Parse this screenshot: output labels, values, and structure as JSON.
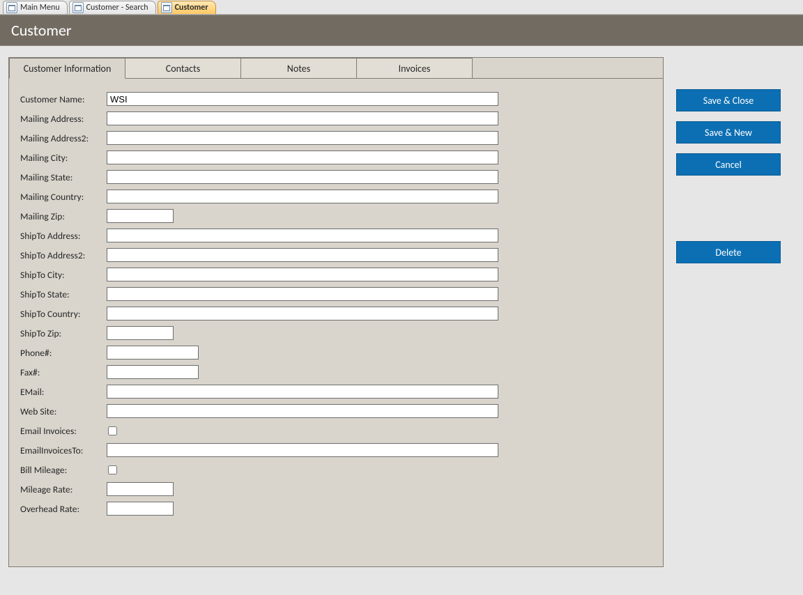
{
  "tabstrip": {
    "tabs": [
      {
        "label": "Main Menu",
        "active": false
      },
      {
        "label": "Customer - Search",
        "active": false
      },
      {
        "label": "Customer",
        "active": true
      }
    ]
  },
  "header": {
    "title": "Customer"
  },
  "form": {
    "tabs": [
      {
        "label": "Customer Information",
        "active": true
      },
      {
        "label": "Contacts",
        "active": false
      },
      {
        "label": "Notes",
        "active": false
      },
      {
        "label": "Invoices",
        "active": false
      }
    ],
    "fields": {
      "customer_name": {
        "label": "Customer Name:",
        "value": "WSI",
        "width": "long"
      },
      "mailing_address": {
        "label": "Mailing Address:",
        "value": "",
        "width": "long"
      },
      "mailing_address2": {
        "label": "Mailing Address2:",
        "value": "",
        "width": "long"
      },
      "mailing_city": {
        "label": "Mailing City:",
        "value": "",
        "width": "long"
      },
      "mailing_state": {
        "label": "Mailing State:",
        "value": "",
        "width": "long"
      },
      "mailing_country": {
        "label": "Mailing Country:",
        "value": "",
        "width": "long"
      },
      "mailing_zip": {
        "label": "Mailing Zip:",
        "value": "",
        "width": "short"
      },
      "shipto_address": {
        "label": "ShipTo Address:",
        "value": "",
        "width": "long"
      },
      "shipto_address2": {
        "label": "ShipTo Address2:",
        "value": "",
        "width": "long"
      },
      "shipto_city": {
        "label": "ShipTo City:",
        "value": "",
        "width": "long"
      },
      "shipto_state": {
        "label": "ShipTo State:",
        "value": "",
        "width": "long"
      },
      "shipto_country": {
        "label": "ShipTo Country:",
        "value": "",
        "width": "long"
      },
      "shipto_zip": {
        "label": "ShipTo Zip:",
        "value": "",
        "width": "short"
      },
      "phone": {
        "label": "Phone#:",
        "value": "",
        "width": "med"
      },
      "fax": {
        "label": "Fax#:",
        "value": "",
        "width": "med"
      },
      "email": {
        "label": "EMail:",
        "value": "",
        "width": "long"
      },
      "website": {
        "label": "Web Site:",
        "value": "",
        "width": "long"
      },
      "email_invoices": {
        "label": "Email Invoices:",
        "checked": false
      },
      "email_invoices_to": {
        "label": "EmailInvoicesTo:",
        "value": "",
        "width": "long"
      },
      "bill_mileage": {
        "label": "Bill Mileage:",
        "checked": false
      },
      "mileage_rate": {
        "label": "Mileage Rate:",
        "value": "",
        "width": "short"
      },
      "overhead_rate": {
        "label": "Overhead Rate:",
        "value": "",
        "width": "short"
      }
    }
  },
  "buttons": {
    "save_close": "Save & Close",
    "save_new": "Save & New",
    "cancel": "Cancel",
    "delete": "Delete"
  }
}
